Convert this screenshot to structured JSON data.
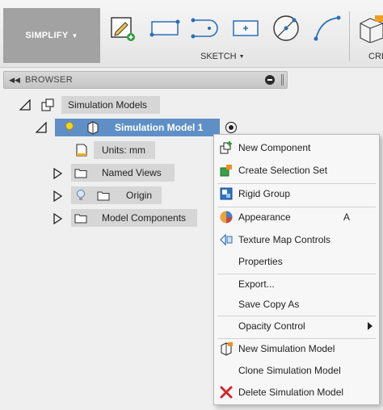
{
  "toolbar": {
    "simplify_label": "SIMPLIFY",
    "sketch_label": "SKETCH",
    "create_label": "CRE",
    "tools": [
      "create-sketch-icon",
      "rectangle-icon",
      "slot-icon",
      "point-rectangle-icon",
      "circle-icon",
      "arc-icon",
      "create-box-icon"
    ]
  },
  "browser": {
    "title": "BROWSER",
    "root_label": "Simulation Models",
    "model_label": "Simulation Model 1",
    "units_label": "Units: mm",
    "children": [
      {
        "label": "Named Views"
      },
      {
        "label": "Origin"
      },
      {
        "label": "Model Components"
      }
    ]
  },
  "context_menu": {
    "items": [
      {
        "label": "New Component",
        "icon": "new-component-icon"
      },
      {
        "label": "Create Selection Set",
        "icon": "selection-set-icon"
      },
      {
        "label": "Rigid Group",
        "icon": "rigid-group-icon"
      },
      {
        "label": "Appearance",
        "icon": "appearance-icon",
        "shortcut": "A"
      },
      {
        "label": "Texture Map Controls",
        "icon": "texture-map-icon"
      },
      {
        "label": "Properties"
      },
      {
        "label": "Export..."
      },
      {
        "label": "Save Copy As"
      },
      {
        "label": "Opacity Control"
      },
      {
        "label": "New Simulation Model",
        "icon": "new-simulation-model-icon"
      },
      {
        "label": "Clone Simulation Model"
      },
      {
        "label": "Delete Simulation Model",
        "icon": "delete-icon"
      }
    ]
  },
  "colors": {
    "selected_node": "#5f8fc6",
    "node_bg": "#d6d6d6",
    "accent_blue": "#2b6fb8",
    "simplify_bg": "#a2a2a2"
  }
}
